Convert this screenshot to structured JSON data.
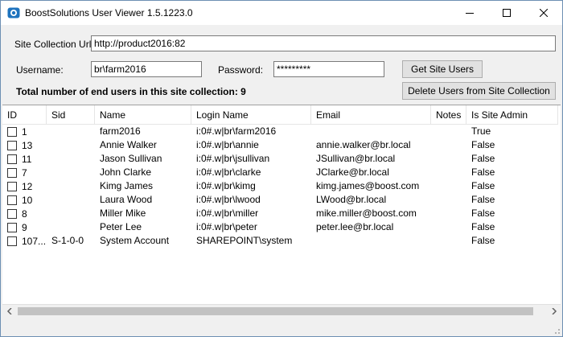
{
  "window": {
    "title": "BoostSolutions User Viewer 1.5.1223.0",
    "accent": "#1e73be"
  },
  "form": {
    "site_url_label": "Site Collection Url:",
    "site_url_value": "http://product2016:82",
    "username_label": "Username:",
    "username_value": "br\\farm2016",
    "password_label": "Password:",
    "password_value": "*********",
    "get_users_label": "Get Site Users",
    "delete_users_label": "Delete Users from Site Collection",
    "total_text": "Total number of end users in this site collection: 9"
  },
  "table": {
    "columns": [
      "ID",
      "Sid",
      "Name",
      "Login Name",
      "Email",
      "Notes",
      "Is Site Admin"
    ],
    "rows": [
      [
        "1",
        "",
        "farm2016",
        "i:0#.w|br\\farm2016",
        "",
        "",
        "True"
      ],
      [
        "13",
        "",
        "Annie Walker",
        "i:0#.w|br\\annie",
        "annie.walker@br.local",
        "",
        "False"
      ],
      [
        "11",
        "",
        "Jason Sullivan",
        "i:0#.w|br\\jsullivan",
        "JSullivan@br.local",
        "",
        "False"
      ],
      [
        "7",
        "",
        "John Clarke",
        "i:0#.w|br\\clarke",
        "JClarke@br.local",
        "",
        "False"
      ],
      [
        "12",
        "",
        "Kimg James",
        "i:0#.w|br\\kimg",
        "kimg.james@boost.com",
        "",
        "False"
      ],
      [
        "10",
        "",
        "Laura Wood",
        "i:0#.w|br\\lwood",
        "LWood@br.local",
        "",
        "False"
      ],
      [
        "8",
        "",
        "Miller Mike",
        "i:0#.w|br\\miller",
        "mike.miller@boost.com",
        "",
        "False"
      ],
      [
        "9",
        "",
        "Peter Lee",
        "i:0#.w|br\\peter",
        "peter.lee@br.local",
        "",
        "False"
      ],
      [
        "107...",
        "S-1-0-0",
        "System Account",
        "SHAREPOINT\\system",
        "",
        "",
        "False"
      ]
    ]
  },
  "icons": {
    "app": "app-icon",
    "minimize": "minimize-icon",
    "maximize": "maximize-icon",
    "close": "close-icon",
    "scroll_left": "chevron-left-icon",
    "scroll_right": "chevron-right-icon",
    "grip": "resize-grip-icon"
  }
}
